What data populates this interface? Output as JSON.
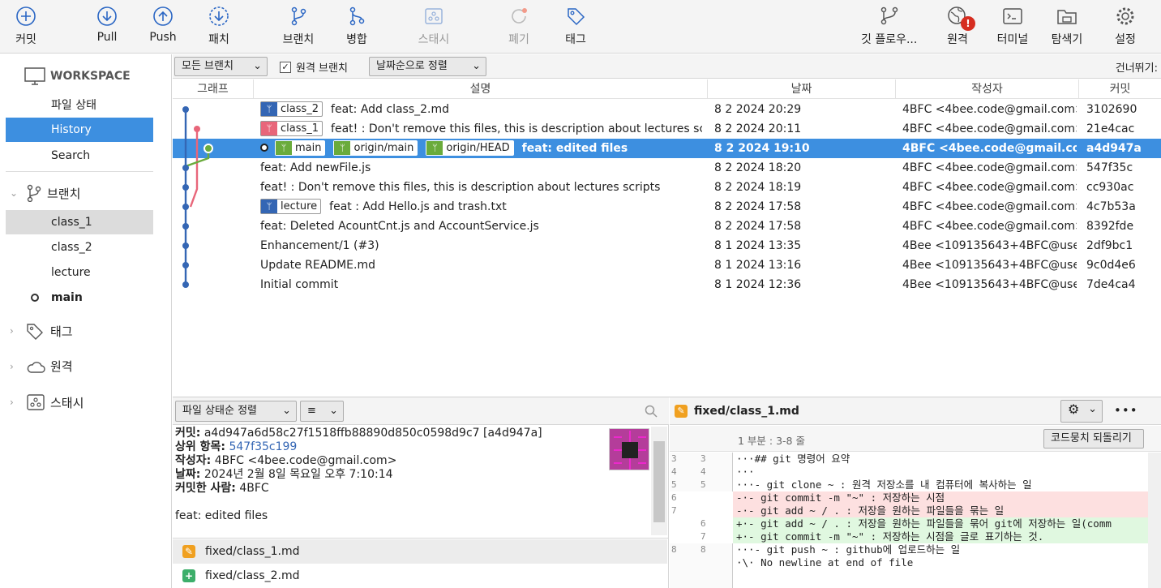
{
  "toolbar": {
    "commit": "커밋",
    "pull": "Pull",
    "push": "Push",
    "patch": "패치",
    "branch": "브랜치",
    "merge": "병합",
    "stash": "스태시",
    "discard": "폐기",
    "tag": "태그",
    "gitflow": "깃 플로우...",
    "remote": "원격",
    "terminal": "터미널",
    "explorer": "탐색기",
    "settings": "설정",
    "remote_badge": "!"
  },
  "sidebar": {
    "workspace": "WORKSPACE",
    "file_status": "파일 상태",
    "history": "History",
    "search": "Search",
    "branches_title": "브랜치",
    "branches": [
      "class_1",
      "class_2",
      "lecture",
      "main"
    ],
    "tags_title": "태그",
    "remotes_title": "원격",
    "stash_title": "스태시"
  },
  "filterbar": {
    "all_branches": "모든 브랜치",
    "remote_branch": "원격 브랜치",
    "sort_by_date": "날짜순으로 정렬",
    "skip": "건너뛰기:"
  },
  "columns": {
    "graph": "그래프",
    "description": "설명",
    "date": "날짜",
    "author": "작성자",
    "commit": "커밋"
  },
  "commits": [
    {
      "tags": [
        "class_2"
      ],
      "desc": "feat: Add class_2.md",
      "date": "8 2 2024 20:29",
      "author": "4BFC <4bee.code@gmail.com>",
      "hash": "3102690"
    },
    {
      "tags": [
        "class_1"
      ],
      "desc": "feat! : Don't remove this files, this is description about lectures sc",
      "date": "8 2 2024 20:11",
      "author": "4BFC <4bee.code@gmail.com>",
      "hash": "21e4cac"
    },
    {
      "tags": [
        "main",
        "origin/main",
        "origin/HEAD"
      ],
      "desc": "feat: edited files",
      "date": "8 2 2024 19:10",
      "author": "4BFC <4bee.code@gmail.com",
      "hash": "a4d947a"
    },
    {
      "tags": [],
      "desc": "feat: Add newFile.js",
      "date": "8 2 2024 18:20",
      "author": "4BFC <4bee.code@gmail.com>",
      "hash": "547f35c"
    },
    {
      "tags": [],
      "desc": "feat! : Don't remove this files, this is description about lectures scripts",
      "date": "8 2 2024 18:19",
      "author": "4BFC <4bee.code@gmail.com>",
      "hash": "cc930ac"
    },
    {
      "tags": [
        "lecture"
      ],
      "desc": "feat : Add Hello.js and trash.txt",
      "date": "8 2 2024 17:58",
      "author": "4BFC <4bee.code@gmail.com>",
      "hash": "4c7b53a"
    },
    {
      "tags": [],
      "desc": "feat: Deleted AcountCnt.js and AccountService.js",
      "date": "8 2 2024 17:58",
      "author": "4BFC <4bee.code@gmail.com>",
      "hash": "8392fde"
    },
    {
      "tags": [],
      "desc": "Enhancement/1 (#3)",
      "date": "8 1 2024 13:35",
      "author": "4Bee <109135643+4BFC@user",
      "hash": "2df9bc1"
    },
    {
      "tags": [],
      "desc": "Update README.md",
      "date": "8 1 2024 13:16",
      "author": "4Bee <109135643+4BFC@user",
      "hash": "9c0d4e6"
    },
    {
      "tags": [],
      "desc": "Initial commit",
      "date": "8 1 2024 12:36",
      "author": "4Bee <109135643+4BFC@user",
      "hash": "7de4ca4"
    }
  ],
  "details": {
    "sort_label": "파일 상태순 정렬",
    "list_icon": "≡",
    "commit_label": "커밋:",
    "commit_value": "a4d947a6d58c27f1518ffb88890d850c0598d9c7 [a4d947a]",
    "parent_label": "상위 항목:",
    "parent_value": "547f35c199",
    "author_label": "작성자:",
    "author_value": "4BFC <4bee.code@gmail.com>",
    "date_label": "날짜:",
    "date_value": "2024년 2월 8일 목요일 오후 7:10:14",
    "committer_label": "커밋한 사람:",
    "committer_value": "4BFC",
    "message": "feat: edited files",
    "files": [
      "fixed/class_1.md",
      "fixed/class_2.md"
    ]
  },
  "diff": {
    "file": "fixed/class_1.md",
    "hunk": "1 부분 : 3-8 줄",
    "revert": "코드뭉치 되돌리기",
    "more": "•••",
    "lines": [
      {
        "type": "ctx",
        "o": "3",
        "n": "3",
        "text": "···## git 명령어 요약"
      },
      {
        "type": "ctx",
        "o": "4",
        "n": "4",
        "text": "···"
      },
      {
        "type": "ctx",
        "o": "5",
        "n": "5",
        "text": "···- git clone ~ : 원격 저장소를 내 컴퓨터에 복사하는 일"
      },
      {
        "type": "del",
        "o": "6",
        "n": "",
        "text": "-·- git commit -m \"~\" : 저장하는 시점"
      },
      {
        "type": "del",
        "o": "7",
        "n": "",
        "text": "-·- git add ~ / . : 저장을 원하는 파일들을 묶는 일"
      },
      {
        "type": "add",
        "o": "",
        "n": "6",
        "text": "+·- git add ~ / . : 저장을 원하는 파일들을 묶어 git에 저장하는 일(comm"
      },
      {
        "type": "add",
        "o": "",
        "n": "7",
        "text": "+·- git commit -m \"~\" : 저장하는 시점을 글로 표기하는 것."
      },
      {
        "type": "ctx",
        "o": "8",
        "n": "8",
        "text": "···- git push ~ : github에 업로드하는 일"
      },
      {
        "type": "ctx",
        "o": "",
        "n": "",
        "text": "·\\· No newline at end of file"
      }
    ]
  }
}
